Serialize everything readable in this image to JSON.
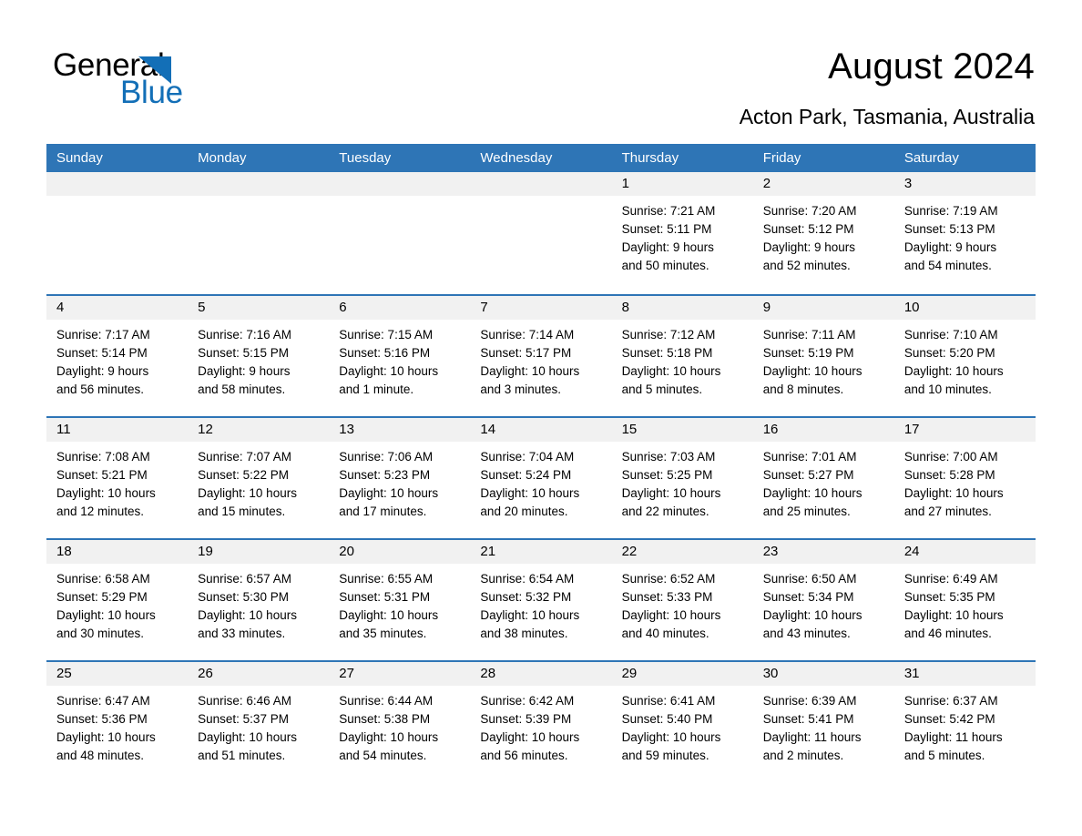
{
  "brand": {
    "name_part1": "General",
    "name_part2": "Blue",
    "accent_color": "#136fb7"
  },
  "header": {
    "month_title": "August 2024",
    "location": "Acton Park, Tasmania, Australia"
  },
  "calendar": {
    "header_bg": "#2e75b6",
    "daynum_bg": "#f1f1f1",
    "weekday_headers": [
      "Sunday",
      "Monday",
      "Tuesday",
      "Wednesday",
      "Thursday",
      "Friday",
      "Saturday"
    ],
    "weeks": [
      [
        {
          "day": "",
          "blank": true
        },
        {
          "day": "",
          "blank": true
        },
        {
          "day": "",
          "blank": true
        },
        {
          "day": "",
          "blank": true
        },
        {
          "day": "1",
          "sunrise": "Sunrise: 7:21 AM",
          "sunset": "Sunset: 5:11 PM",
          "daylight1": "Daylight: 9 hours",
          "daylight2": "and 50 minutes."
        },
        {
          "day": "2",
          "sunrise": "Sunrise: 7:20 AM",
          "sunset": "Sunset: 5:12 PM",
          "daylight1": "Daylight: 9 hours",
          "daylight2": "and 52 minutes."
        },
        {
          "day": "3",
          "sunrise": "Sunrise: 7:19 AM",
          "sunset": "Sunset: 5:13 PM",
          "daylight1": "Daylight: 9 hours",
          "daylight2": "and 54 minutes."
        }
      ],
      [
        {
          "day": "4",
          "sunrise": "Sunrise: 7:17 AM",
          "sunset": "Sunset: 5:14 PM",
          "daylight1": "Daylight: 9 hours",
          "daylight2": "and 56 minutes."
        },
        {
          "day": "5",
          "sunrise": "Sunrise: 7:16 AM",
          "sunset": "Sunset: 5:15 PM",
          "daylight1": "Daylight: 9 hours",
          "daylight2": "and 58 minutes."
        },
        {
          "day": "6",
          "sunrise": "Sunrise: 7:15 AM",
          "sunset": "Sunset: 5:16 PM",
          "daylight1": "Daylight: 10 hours",
          "daylight2": "and 1 minute."
        },
        {
          "day": "7",
          "sunrise": "Sunrise: 7:14 AM",
          "sunset": "Sunset: 5:17 PM",
          "daylight1": "Daylight: 10 hours",
          "daylight2": "and 3 minutes."
        },
        {
          "day": "8",
          "sunrise": "Sunrise: 7:12 AM",
          "sunset": "Sunset: 5:18 PM",
          "daylight1": "Daylight: 10 hours",
          "daylight2": "and 5 minutes."
        },
        {
          "day": "9",
          "sunrise": "Sunrise: 7:11 AM",
          "sunset": "Sunset: 5:19 PM",
          "daylight1": "Daylight: 10 hours",
          "daylight2": "and 8 minutes."
        },
        {
          "day": "10",
          "sunrise": "Sunrise: 7:10 AM",
          "sunset": "Sunset: 5:20 PM",
          "daylight1": "Daylight: 10 hours",
          "daylight2": "and 10 minutes."
        }
      ],
      [
        {
          "day": "11",
          "sunrise": "Sunrise: 7:08 AM",
          "sunset": "Sunset: 5:21 PM",
          "daylight1": "Daylight: 10 hours",
          "daylight2": "and 12 minutes."
        },
        {
          "day": "12",
          "sunrise": "Sunrise: 7:07 AM",
          "sunset": "Sunset: 5:22 PM",
          "daylight1": "Daylight: 10 hours",
          "daylight2": "and 15 minutes."
        },
        {
          "day": "13",
          "sunrise": "Sunrise: 7:06 AM",
          "sunset": "Sunset: 5:23 PM",
          "daylight1": "Daylight: 10 hours",
          "daylight2": "and 17 minutes."
        },
        {
          "day": "14",
          "sunrise": "Sunrise: 7:04 AM",
          "sunset": "Sunset: 5:24 PM",
          "daylight1": "Daylight: 10 hours",
          "daylight2": "and 20 minutes."
        },
        {
          "day": "15",
          "sunrise": "Sunrise: 7:03 AM",
          "sunset": "Sunset: 5:25 PM",
          "daylight1": "Daylight: 10 hours",
          "daylight2": "and 22 minutes."
        },
        {
          "day": "16",
          "sunrise": "Sunrise: 7:01 AM",
          "sunset": "Sunset: 5:27 PM",
          "daylight1": "Daylight: 10 hours",
          "daylight2": "and 25 minutes."
        },
        {
          "day": "17",
          "sunrise": "Sunrise: 7:00 AM",
          "sunset": "Sunset: 5:28 PM",
          "daylight1": "Daylight: 10 hours",
          "daylight2": "and 27 minutes."
        }
      ],
      [
        {
          "day": "18",
          "sunrise": "Sunrise: 6:58 AM",
          "sunset": "Sunset: 5:29 PM",
          "daylight1": "Daylight: 10 hours",
          "daylight2": "and 30 minutes."
        },
        {
          "day": "19",
          "sunrise": "Sunrise: 6:57 AM",
          "sunset": "Sunset: 5:30 PM",
          "daylight1": "Daylight: 10 hours",
          "daylight2": "and 33 minutes."
        },
        {
          "day": "20",
          "sunrise": "Sunrise: 6:55 AM",
          "sunset": "Sunset: 5:31 PM",
          "daylight1": "Daylight: 10 hours",
          "daylight2": "and 35 minutes."
        },
        {
          "day": "21",
          "sunrise": "Sunrise: 6:54 AM",
          "sunset": "Sunset: 5:32 PM",
          "daylight1": "Daylight: 10 hours",
          "daylight2": "and 38 minutes."
        },
        {
          "day": "22",
          "sunrise": "Sunrise: 6:52 AM",
          "sunset": "Sunset: 5:33 PM",
          "daylight1": "Daylight: 10 hours",
          "daylight2": "and 40 minutes."
        },
        {
          "day": "23",
          "sunrise": "Sunrise: 6:50 AM",
          "sunset": "Sunset: 5:34 PM",
          "daylight1": "Daylight: 10 hours",
          "daylight2": "and 43 minutes."
        },
        {
          "day": "24",
          "sunrise": "Sunrise: 6:49 AM",
          "sunset": "Sunset: 5:35 PM",
          "daylight1": "Daylight: 10 hours",
          "daylight2": "and 46 minutes."
        }
      ],
      [
        {
          "day": "25",
          "sunrise": "Sunrise: 6:47 AM",
          "sunset": "Sunset: 5:36 PM",
          "daylight1": "Daylight: 10 hours",
          "daylight2": "and 48 minutes."
        },
        {
          "day": "26",
          "sunrise": "Sunrise: 6:46 AM",
          "sunset": "Sunset: 5:37 PM",
          "daylight1": "Daylight: 10 hours",
          "daylight2": "and 51 minutes."
        },
        {
          "day": "27",
          "sunrise": "Sunrise: 6:44 AM",
          "sunset": "Sunset: 5:38 PM",
          "daylight1": "Daylight: 10 hours",
          "daylight2": "and 54 minutes."
        },
        {
          "day": "28",
          "sunrise": "Sunrise: 6:42 AM",
          "sunset": "Sunset: 5:39 PM",
          "daylight1": "Daylight: 10 hours",
          "daylight2": "and 56 minutes."
        },
        {
          "day": "29",
          "sunrise": "Sunrise: 6:41 AM",
          "sunset": "Sunset: 5:40 PM",
          "daylight1": "Daylight: 10 hours",
          "daylight2": "and 59 minutes."
        },
        {
          "day": "30",
          "sunrise": "Sunrise: 6:39 AM",
          "sunset": "Sunset: 5:41 PM",
          "daylight1": "Daylight: 11 hours",
          "daylight2": "and 2 minutes."
        },
        {
          "day": "31",
          "sunrise": "Sunrise: 6:37 AM",
          "sunset": "Sunset: 5:42 PM",
          "daylight1": "Daylight: 11 hours",
          "daylight2": "and 5 minutes."
        }
      ]
    ]
  }
}
